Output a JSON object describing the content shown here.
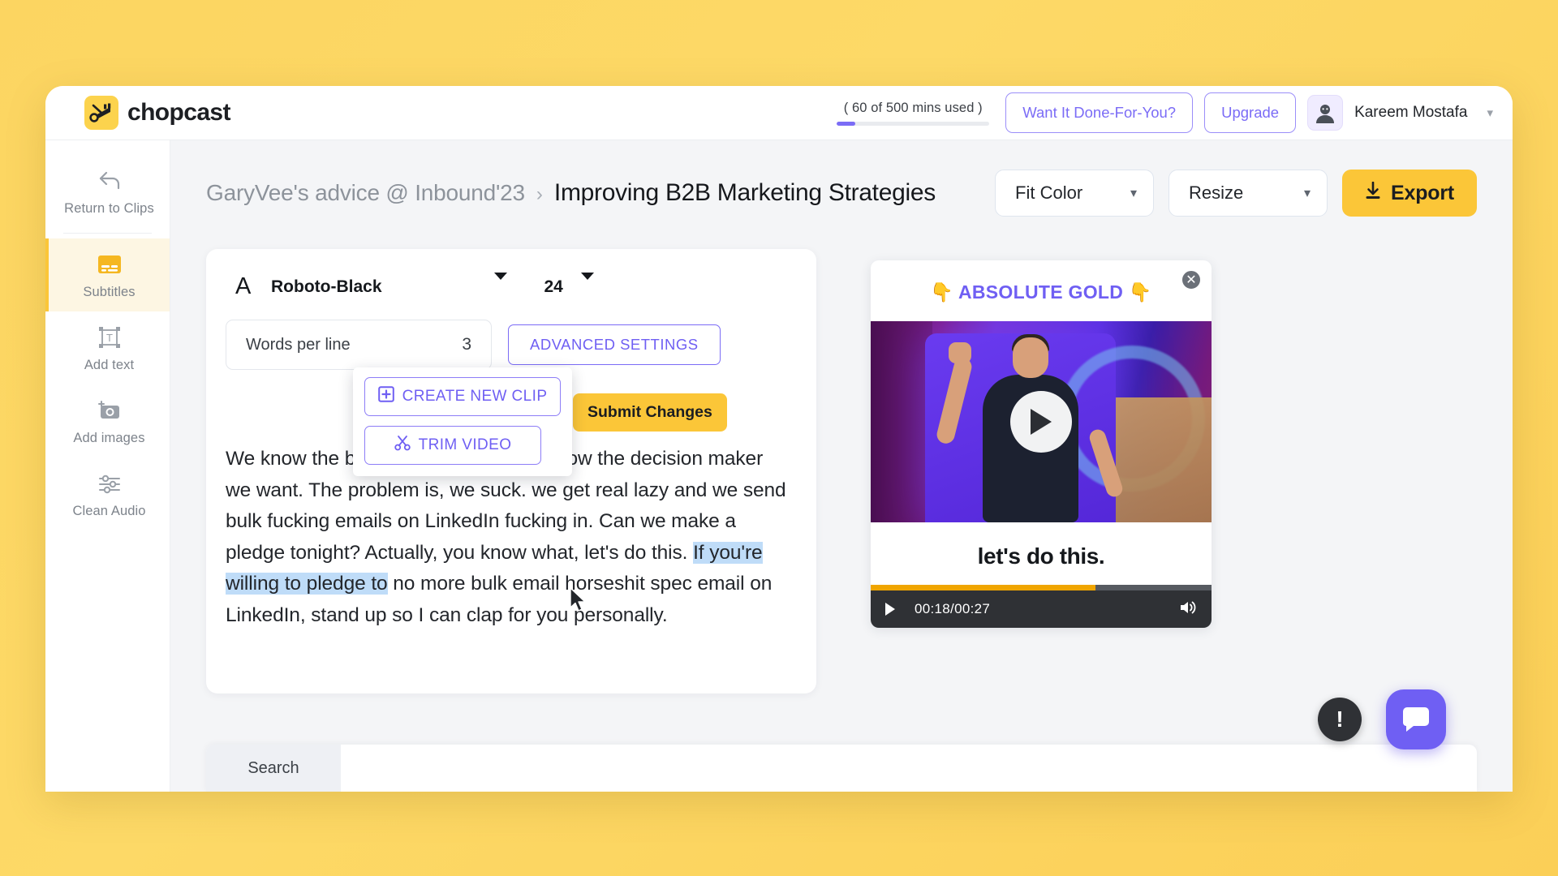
{
  "brand": {
    "name": "chopcast",
    "logo_icon": "scissors-film-icon"
  },
  "topbar": {
    "usage_text": "( 60 of 500 mins used )",
    "done_for_you_label": "Want It Done-For-You?",
    "upgrade_label": "Upgrade",
    "user_name": "Kareem Mostafa",
    "avatar_icon": "user-avatar",
    "caret_icon": "chevron-down-icon"
  },
  "sidebar": {
    "items": [
      {
        "label": "Return to Clips",
        "icon": "back-arrow-icon",
        "active": false
      },
      {
        "label": "Subtitles",
        "icon": "subtitles-icon",
        "active": true
      },
      {
        "label": "Add text",
        "icon": "text-box-icon",
        "active": false
      },
      {
        "label": "Add images",
        "icon": "camera-plus-icon",
        "active": false
      },
      {
        "label": "Clean Audio",
        "icon": "sliders-icon",
        "active": false
      }
    ]
  },
  "header": {
    "breadcrumb_parent": "GaryVee's advice @ Inbound'23",
    "breadcrumb_separator": "›",
    "breadcrumb_current": "Improving B2B Marketing Strategies",
    "fit_color_label": "Fit Color",
    "resize_label": "Resize",
    "export_label": "Export",
    "export_icon": "download-icon",
    "chevron_icon": "chevron-down-icon"
  },
  "editor": {
    "font_letter": "A",
    "font_family_value": "Roboto-Black",
    "font_size_value": "24",
    "words_per_line_label": "Words per line",
    "words_per_line_value": "3",
    "advanced_settings_label": "ADVANCED SETTINGS",
    "submit_label": "Submit Changes",
    "transcript_part1": "We know the business we want. We know the decision maker we want. The problem is, we suck. we get real lazy and we send bulk fucking emails on LinkedIn fucking in. Can we make a pledge tonight? Actually, you know what, let's do this. ",
    "transcript_highlight": "If you're willing to pledge to",
    "transcript_part2": " no more bulk email horseshit spec email on LinkedIn, stand up so I can clap for you personally."
  },
  "context_menu": {
    "create_clip_label": "CREATE NEW CLIP",
    "create_clip_icon": "plus-square-icon",
    "trim_video_label": "TRIM VIDEO",
    "trim_video_icon": "scissors-icon"
  },
  "preview": {
    "title": "👇 ABSOLUTE GOLD 👇",
    "title_color": "#6f5ff3",
    "close_icon": "close-circle-icon",
    "play_icon": "play-icon",
    "caption": "let's do this.",
    "time": "00:18/00:27",
    "progress_percent": 66,
    "controls_play_icon": "play-icon",
    "volume_icon": "volume-icon"
  },
  "bottom": {
    "search_label": "Search"
  },
  "fabs": {
    "alert_icon": "exclamation-icon",
    "alert_label": "!",
    "chat_icon": "chat-bubble-icon"
  }
}
